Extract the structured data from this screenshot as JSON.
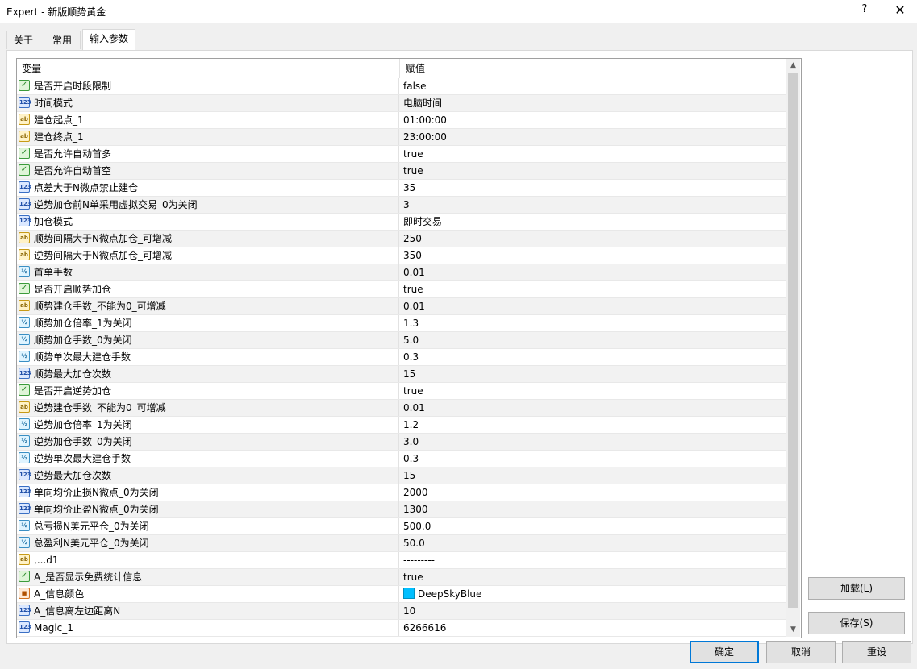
{
  "window": {
    "title": "Expert - 新版顺势黄金",
    "help_label": "?",
    "close_label": "✕"
  },
  "tabs": [
    {
      "label": "关于",
      "active": false
    },
    {
      "label": "常用",
      "active": false
    },
    {
      "label": "输入参数",
      "active": true
    }
  ],
  "grid": {
    "col_variable": "变量",
    "col_value": "赋值",
    "scroll_up_icon": "▲",
    "scroll_down_icon": "▼",
    "rows": [
      {
        "type": "bool",
        "name": "是否开启时段限制",
        "value": "false"
      },
      {
        "type": "int",
        "name": "时间模式",
        "value": "电脑时间"
      },
      {
        "type": "str",
        "name": "建仓起点_1",
        "value": "01:00:00"
      },
      {
        "type": "str",
        "name": "建仓终点_1",
        "value": "23:00:00"
      },
      {
        "type": "bool",
        "name": "是否允许自动首多",
        "value": "true"
      },
      {
        "type": "bool",
        "name": "是否允许自动首空",
        "value": "true"
      },
      {
        "type": "int",
        "name": "点差大于N微点禁止建仓",
        "value": "35"
      },
      {
        "type": "int",
        "name": "逆势加仓前N单采用虚拟交易_0为关闭",
        "value": "3"
      },
      {
        "type": "int",
        "name": "加仓模式",
        "value": "即时交易"
      },
      {
        "type": "str",
        "name": "顺势间隔大于N微点加仓_可增减",
        "value": "250"
      },
      {
        "type": "str",
        "name": "逆势间隔大于N微点加仓_可增减",
        "value": "350"
      },
      {
        "type": "dbl",
        "name": "首单手数",
        "value": "0.01"
      },
      {
        "type": "bool",
        "name": "是否开启顺势加仓",
        "value": "true"
      },
      {
        "type": "str",
        "name": "顺势建仓手数_不能为0_可增减",
        "value": "0.01"
      },
      {
        "type": "dbl",
        "name": "顺势加仓倍率_1为关闭",
        "value": "1.3"
      },
      {
        "type": "dbl",
        "name": "顺势加仓手数_0为关闭",
        "value": "5.0"
      },
      {
        "type": "dbl",
        "name": "顺势单次最大建仓手数",
        "value": "0.3"
      },
      {
        "type": "int",
        "name": "顺势最大加仓次数",
        "value": "15"
      },
      {
        "type": "bool",
        "name": "是否开启逆势加仓",
        "value": "true"
      },
      {
        "type": "str",
        "name": "逆势建仓手数_不能为0_可增减",
        "value": "0.01"
      },
      {
        "type": "dbl",
        "name": "逆势加仓倍率_1为关闭",
        "value": "1.2"
      },
      {
        "type": "dbl",
        "name": "逆势加仓手数_0为关闭",
        "value": "3.0"
      },
      {
        "type": "dbl",
        "name": "逆势单次最大建仓手数",
        "value": "0.3"
      },
      {
        "type": "int",
        "name": "逆势最大加仓次数",
        "value": "15"
      },
      {
        "type": "int",
        "name": "单向均价止损N微点_0为关闭",
        "value": "2000"
      },
      {
        "type": "int",
        "name": "单向均价止盈N微点_0为关闭",
        "value": "1300"
      },
      {
        "type": "dbl",
        "name": "总亏损N美元平仓_0为关闭",
        "value": "500.0"
      },
      {
        "type": "dbl",
        "name": "总盈利N美元平仓_0为关闭",
        "value": "50.0"
      },
      {
        "type": "str",
        "name": ",...d1",
        "value": "---------"
      },
      {
        "type": "bool",
        "name": "A_是否显示免费统计信息",
        "value": "true"
      },
      {
        "type": "color",
        "name": "A_信息颜色",
        "value": "DeepSkyBlue",
        "swatch": "#00bfff"
      },
      {
        "type": "int",
        "name": "A_信息离左边距离N",
        "value": "10"
      },
      {
        "type": "int",
        "name": "Magic_1",
        "value": "6266616"
      }
    ]
  },
  "icons": {
    "bool": "check-icon",
    "int": "integer-icon",
    "str": "string-icon",
    "dbl": "double-icon",
    "color": "color-icon"
  },
  "buttons": {
    "load": "加载(L)",
    "save": "保存(S)",
    "ok": "确定",
    "cancel": "取消",
    "reset": "重设"
  }
}
